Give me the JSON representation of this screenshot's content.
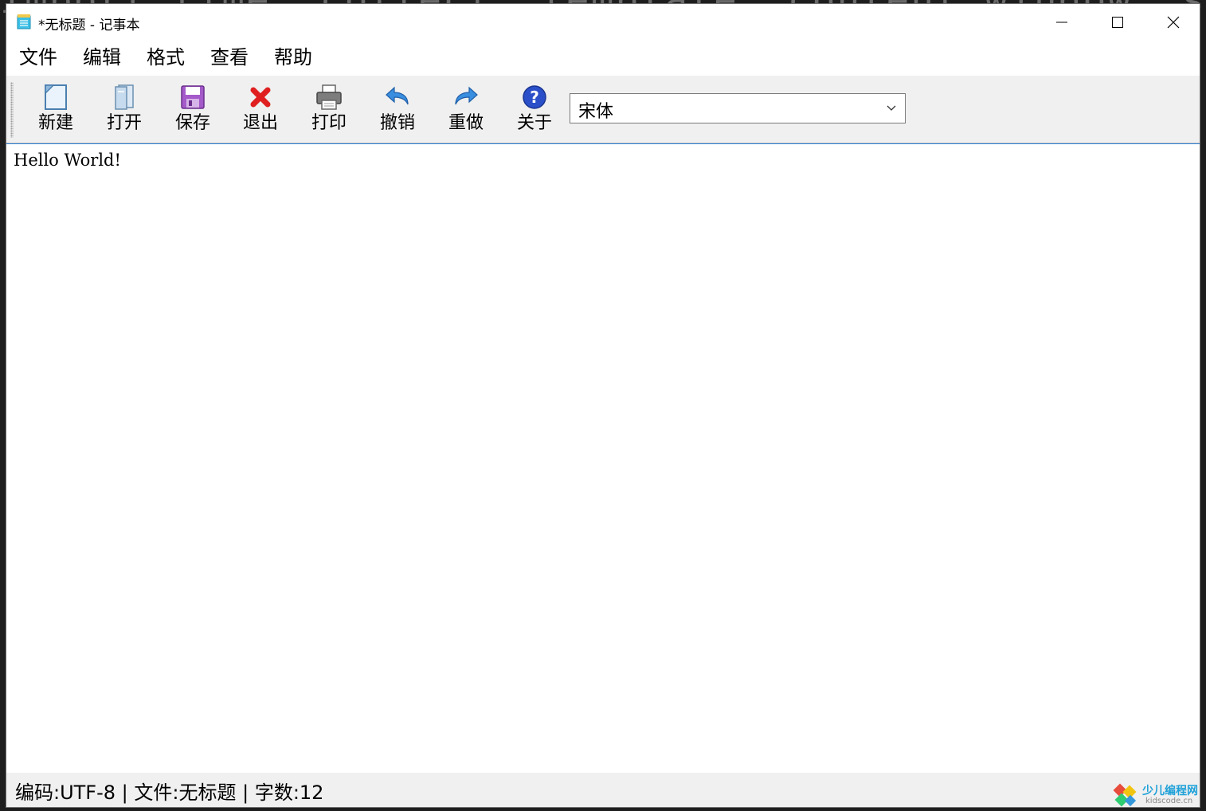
{
  "window": {
    "title": "*无标题 - 记事本"
  },
  "menu": [
    {
      "label": "文件"
    },
    {
      "label": "编辑"
    },
    {
      "label": "格式"
    },
    {
      "label": "查看"
    },
    {
      "label": "帮助"
    }
  ],
  "toolbar": {
    "buttons": [
      {
        "label": "新建",
        "icon": "new-document-icon"
      },
      {
        "label": "打开",
        "icon": "open-file-icon"
      },
      {
        "label": "保存",
        "icon": "save-icon"
      },
      {
        "label": "退出",
        "icon": "exit-icon"
      },
      {
        "label": "打印",
        "icon": "printer-icon"
      },
      {
        "label": "撤销",
        "icon": "undo-icon"
      },
      {
        "label": "重做",
        "icon": "redo-icon"
      },
      {
        "label": "关于",
        "icon": "help-icon"
      }
    ],
    "font_select": {
      "value": "宋体"
    }
  },
  "editor": {
    "content": "Hello World!"
  },
  "status": {
    "encoding": "编码:UTF-8",
    "file": " | 文件:无标题",
    "count": " | 字数:12"
  },
  "watermark": {
    "name": "少儿编程网",
    "site": "kidscode.cn"
  },
  "colors": {
    "accent": "#2f7fd6",
    "toolbar_bg": "#f0f0f0",
    "exit_red": "#e02020",
    "help_blue": "#2a4fc9"
  }
}
